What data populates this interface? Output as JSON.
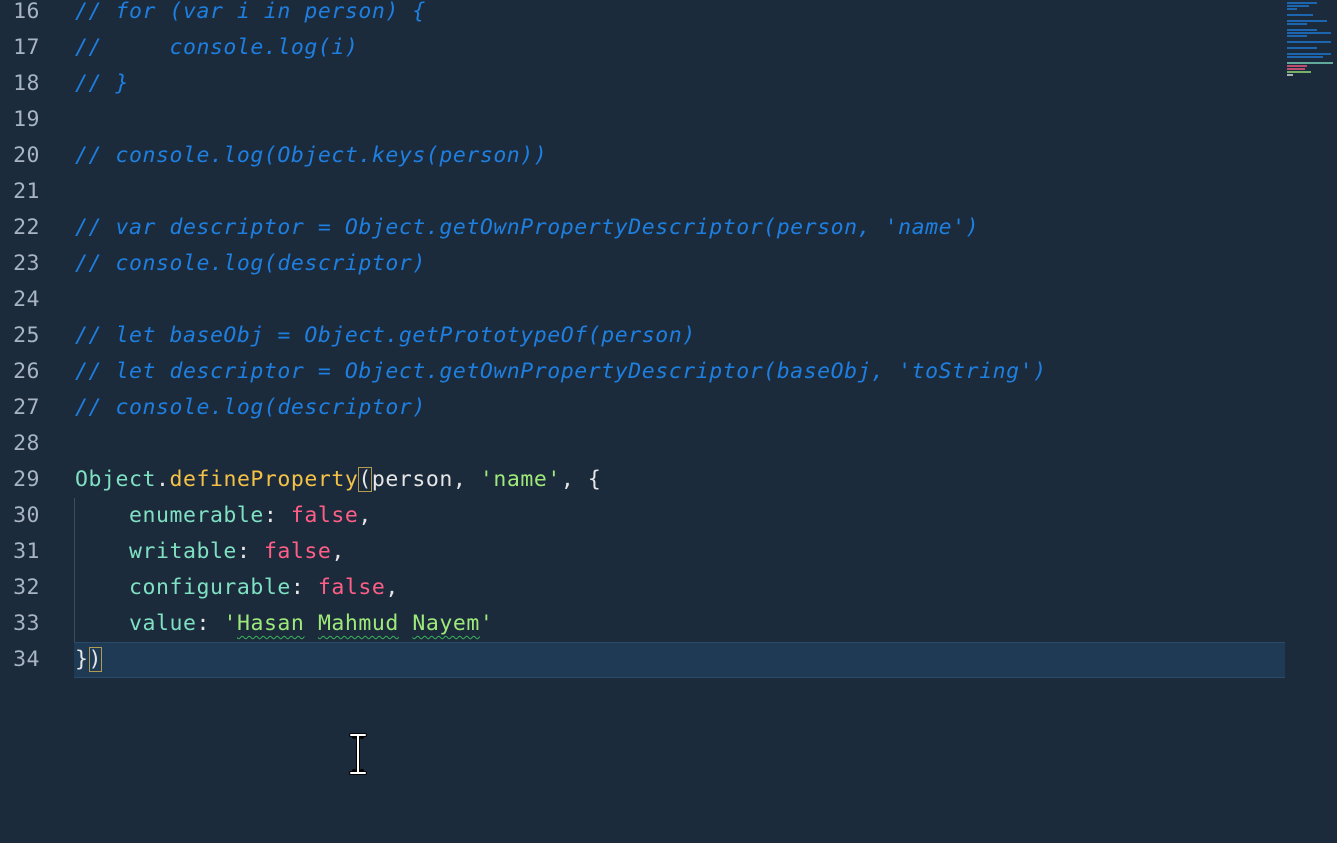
{
  "editor": {
    "lines": [
      {
        "number": "16",
        "tokens": [
          {
            "t": "// for (var i in person) {",
            "c": "comment"
          }
        ]
      },
      {
        "number": "17",
        "tokens": [
          {
            "t": "//     console.log(i)",
            "c": "comment"
          }
        ]
      },
      {
        "number": "18",
        "tokens": [
          {
            "t": "// }",
            "c": "comment"
          }
        ]
      },
      {
        "number": "19",
        "tokens": []
      },
      {
        "number": "20",
        "tokens": [
          {
            "t": "// console.log(Object.keys(person))",
            "c": "comment"
          }
        ]
      },
      {
        "number": "21",
        "tokens": []
      },
      {
        "number": "22",
        "tokens": [
          {
            "t": "// var descriptor = Object.getOwnPropertyDescriptor(person, 'name')",
            "c": "comment"
          }
        ]
      },
      {
        "number": "23",
        "tokens": [
          {
            "t": "// console.log(descriptor)",
            "c": "comment"
          }
        ]
      },
      {
        "number": "24",
        "tokens": []
      },
      {
        "number": "25",
        "tokens": [
          {
            "t": "// let baseObj = Object.getPrototypeOf(person)",
            "c": "comment"
          }
        ]
      },
      {
        "number": "26",
        "tokens": [
          {
            "t": "// let descriptor = Object.getOwnPropertyDescriptor(baseObj, 'toString')",
            "c": "comment"
          }
        ]
      },
      {
        "number": "27",
        "tokens": [
          {
            "t": "// console.log(descriptor)",
            "c": "comment"
          }
        ]
      },
      {
        "number": "28",
        "tokens": []
      },
      {
        "number": "29",
        "tokens": [
          {
            "t": "Object",
            "c": "obj"
          },
          {
            "t": ".",
            "c": "punc"
          },
          {
            "t": "defineProperty",
            "c": "method"
          },
          {
            "t": "(",
            "c": "punc bracket-match"
          },
          {
            "t": "person",
            "c": "ident"
          },
          {
            "t": ", ",
            "c": "punc"
          },
          {
            "t": "'name'",
            "c": "str"
          },
          {
            "t": ", {",
            "c": "punc"
          }
        ]
      },
      {
        "number": "30",
        "tokens": [
          {
            "t": "    enumerable",
            "c": "prop"
          },
          {
            "t": ": ",
            "c": "punc"
          },
          {
            "t": "false",
            "c": "bool"
          },
          {
            "t": ",",
            "c": "punc"
          }
        ]
      },
      {
        "number": "31",
        "tokens": [
          {
            "t": "    writable",
            "c": "prop"
          },
          {
            "t": ": ",
            "c": "punc"
          },
          {
            "t": "false",
            "c": "bool"
          },
          {
            "t": ",",
            "c": "punc"
          }
        ]
      },
      {
        "number": "32",
        "tokens": [
          {
            "t": "    configurable",
            "c": "prop"
          },
          {
            "t": ": ",
            "c": "punc"
          },
          {
            "t": "false",
            "c": "bool"
          },
          {
            "t": ",",
            "c": "punc"
          }
        ]
      },
      {
        "number": "33",
        "tokens": [
          {
            "t": "    value",
            "c": "prop"
          },
          {
            "t": ": ",
            "c": "punc"
          },
          {
            "t": "'",
            "c": "str"
          },
          {
            "t": "Hasan",
            "c": "str squiggle"
          },
          {
            "t": " ",
            "c": "str"
          },
          {
            "t": "Mahmud",
            "c": "str squiggle"
          },
          {
            "t": " ",
            "c": "str"
          },
          {
            "t": "Nayem",
            "c": "str squiggle"
          },
          {
            "t": "'",
            "c": "str"
          }
        ]
      },
      {
        "number": "34",
        "tokens": [
          {
            "t": "}",
            "c": "punc"
          },
          {
            "t": ")",
            "c": "punc bracket-match"
          }
        ]
      }
    ],
    "current_line": "34"
  },
  "colors": {
    "background": "#1b2b3c",
    "comment": "#1e7fe0",
    "string": "#9ee97a",
    "boolean": "#ff5f87",
    "method": "#f5c247",
    "property": "#7fe0c2"
  },
  "cursor": {
    "icon": "text-cursor-icon"
  }
}
